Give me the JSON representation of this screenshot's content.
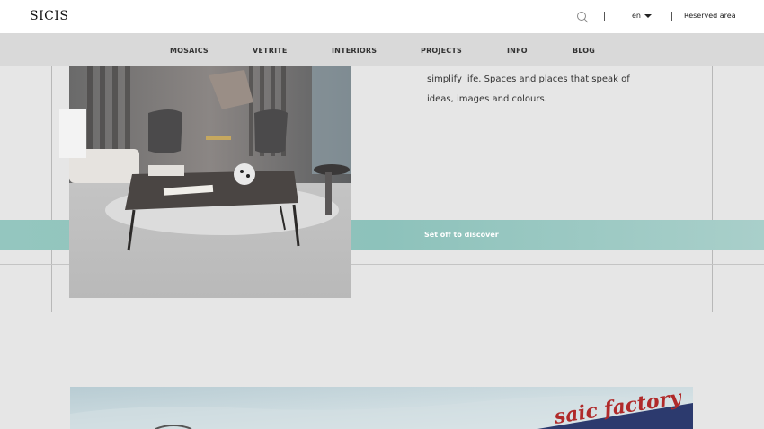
{
  "header": {
    "logo": "SICIS",
    "language": "en",
    "reserved_area": "Reserved area",
    "icons": {
      "search": "search-icon",
      "language_caret": "chevron-down-icon"
    }
  },
  "nav": {
    "items": [
      {
        "label": "MOSAICS"
      },
      {
        "label": "VETRITE"
      },
      {
        "label": "INTERIORS"
      },
      {
        "label": "PROJECTS"
      },
      {
        "label": "INFO"
      },
      {
        "label": "BLOG"
      }
    ]
  },
  "content": {
    "line1": "simplify life. Spaces and places that speak of",
    "line2": "ideas, images and colours.",
    "cta": "Set off to discover"
  },
  "bottom_image": {
    "sign_text": "saic factory"
  },
  "colors": {
    "accent_teal": "#8dc2bb",
    "nav_bg": "#d9d9d9",
    "page_bg": "#e6e6e6"
  }
}
